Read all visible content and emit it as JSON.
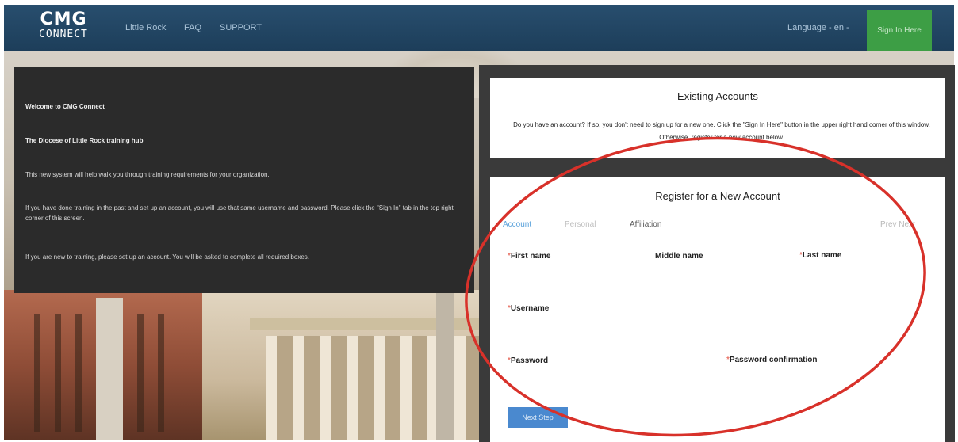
{
  "header": {
    "logo_top": "CMG",
    "logo_bottom": "CONNECT",
    "nav": [
      "Little Rock",
      "FAQ",
      "SUPPORT"
    ],
    "language": "Language - en -",
    "signin_label": "Sign In Here"
  },
  "welcome": {
    "line1": "Welcome to CMG Connect",
    "line2": "The Diocese of Little Rock training hub",
    "line3": "This new system will help walk you through training requirements for your organization.",
    "line4": "If you have done training in the past and set up an account, you will use that same username and password. Please click the \"Sign In\" tab in the top right corner of this screen.",
    "line5": "If you are new to training, please set up an account. You will be asked to complete all required boxes."
  },
  "existing": {
    "title": "Existing Accounts",
    "body": "Do you have an account? If so, you don't need to sign up for a new one. Click the \"Sign In Here\" button in the upper right hand corner of this window. Otherwise, register for a new account below."
  },
  "register": {
    "title": "Register for a New Account",
    "tabs": [
      "Account",
      "Personal",
      "Affiliation"
    ],
    "prev_next": "Prev  Next",
    "required_mark": "*",
    "fields": {
      "first_name": "First name",
      "middle_name": "Middle name",
      "last_name": "Last name",
      "username": "Username",
      "password": "Password",
      "password_confirmation": "Password confirmation"
    },
    "next_step": "Next Step"
  },
  "colors": {
    "header_bg": "#1d3e5a",
    "signin_bg": "#3d9e45",
    "accent_blue": "#4a89cf",
    "required_red": "#e24b3b",
    "annotation_oval": "#d8312a"
  }
}
